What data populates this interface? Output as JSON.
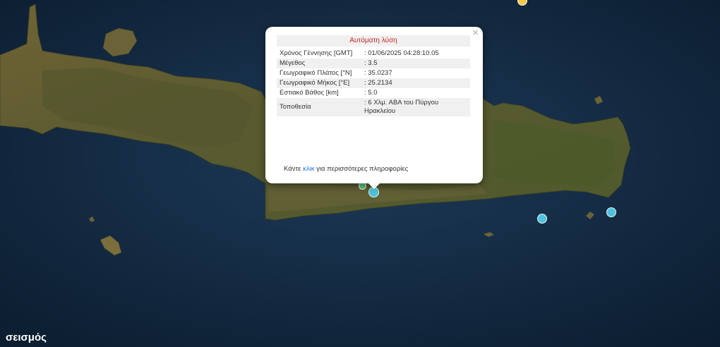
{
  "popup": {
    "title": "Αυτόματη λύση",
    "close_glyph": "×",
    "rows": [
      {
        "label": "Χρόνος Γέννησης [GMT]",
        "value": ": 01/06/2025 04:28:10.05"
      },
      {
        "label": "Μέγεθος",
        "value": ": 3.5"
      },
      {
        "label": "Γεωγραφικό Πλάτος [°N]",
        "value": ": 35.0237"
      },
      {
        "label": "Γεωγραφικό Μήκος [°E]",
        "value": ": 25.2134"
      },
      {
        "label": "Εστιακό Βάθος [km]",
        "value": ": 5.0"
      },
      {
        "label": "Τοποθεσία",
        "value": ": 6 Χλμ. ΑΒΑ του Πύργου\nΗρακλείου"
      }
    ],
    "more_prefix": "Κάντε ",
    "more_link": "κλικ",
    "more_suffix": " για περισσότερες πληροφορίες"
  },
  "caption": "σεισμός",
  "colors": {
    "sea": "#0f2338",
    "land": "#5e5a33",
    "marker_cyan": "#4fc3dc",
    "marker_yellow": "#f2c94c",
    "marker_green": "#5cc07a"
  }
}
